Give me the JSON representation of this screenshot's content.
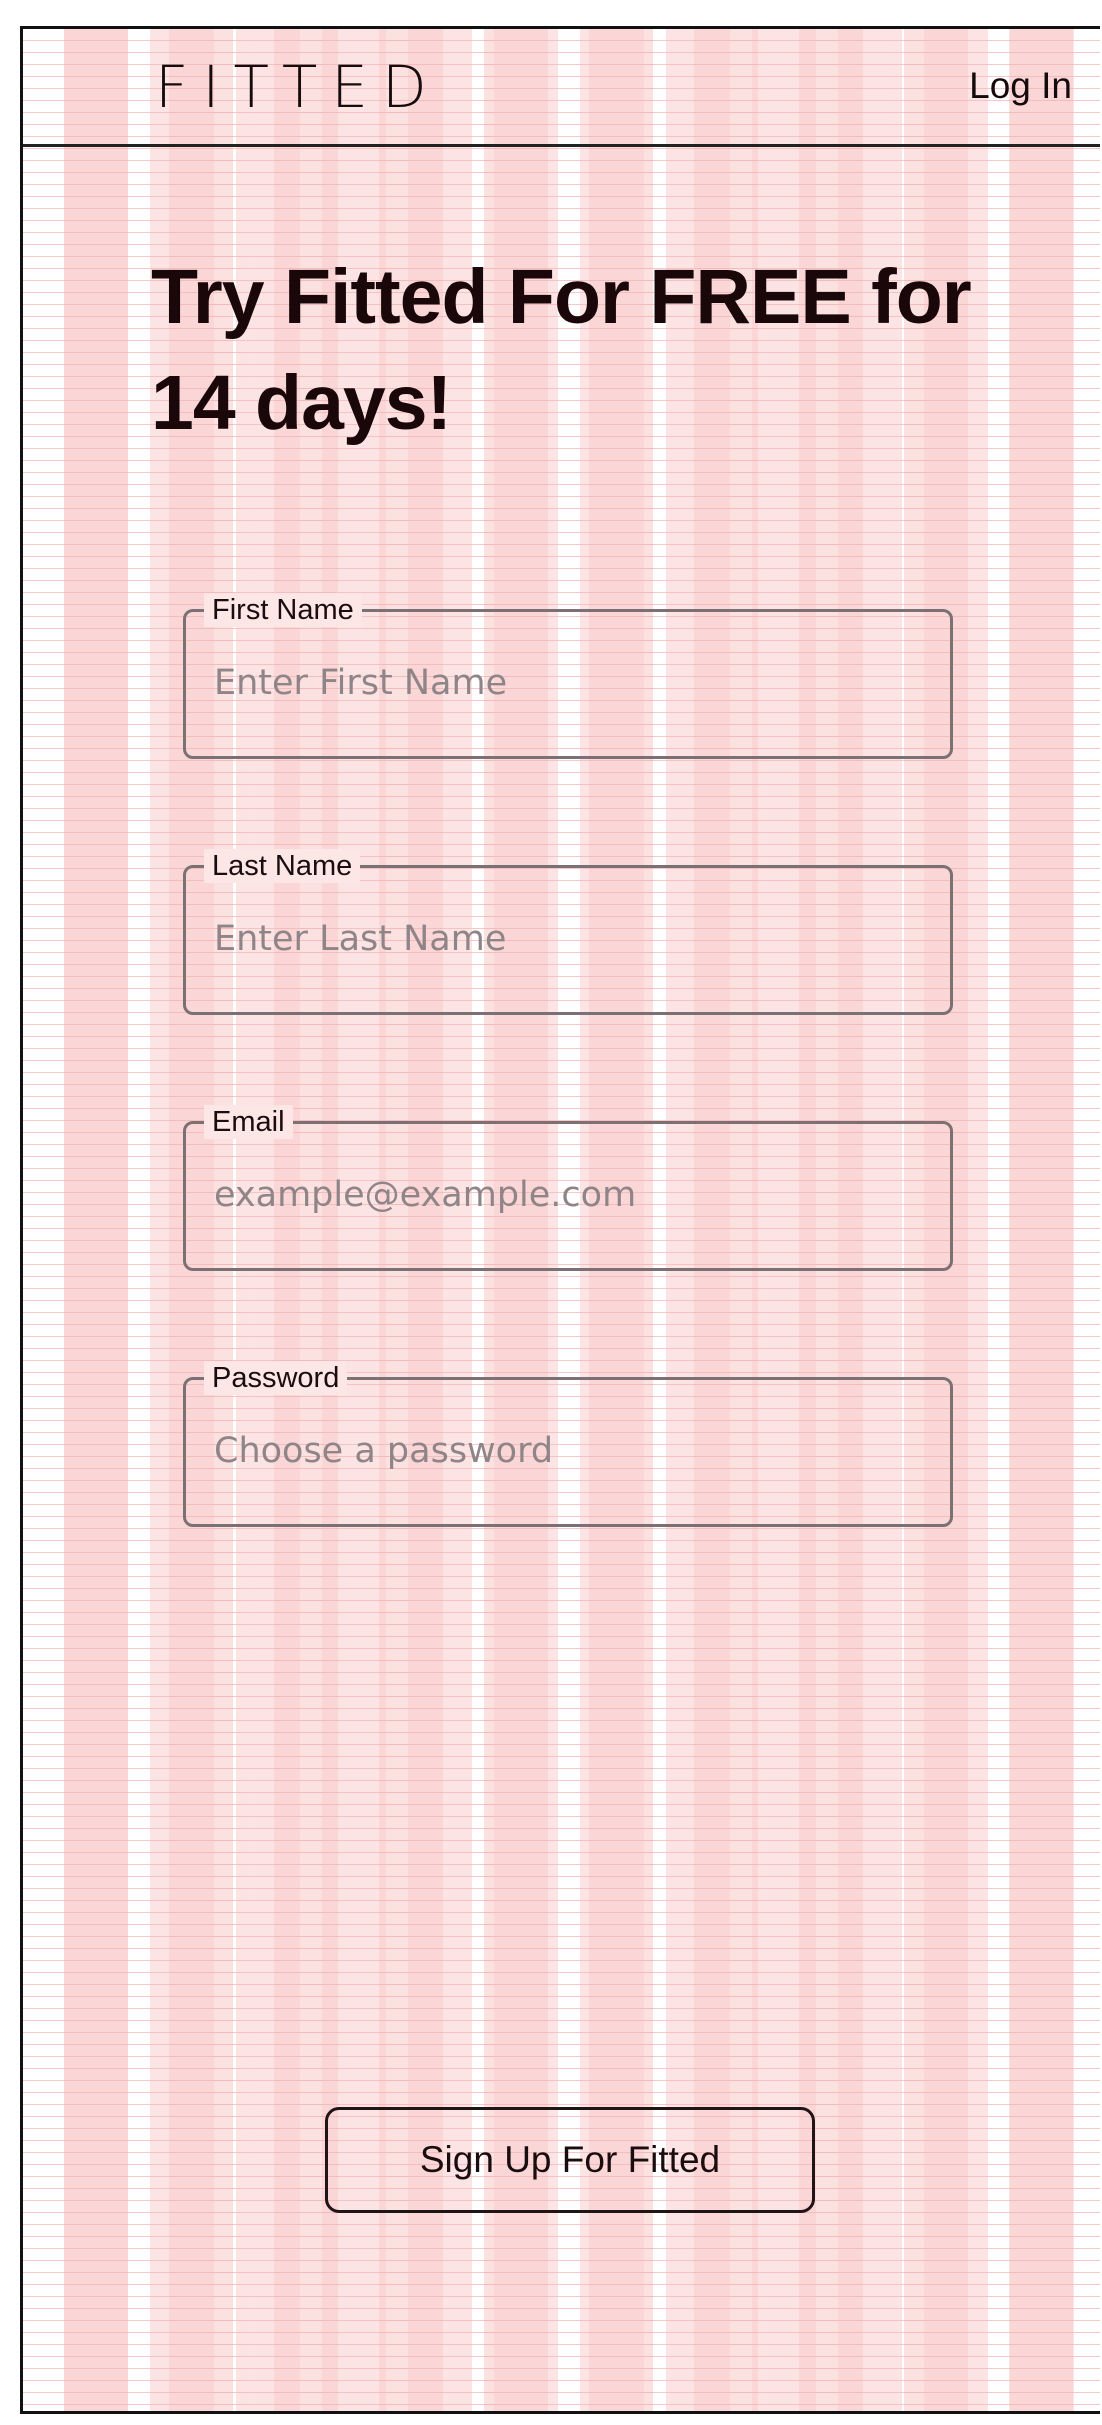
{
  "header": {
    "logo": "FITTED",
    "login_label": "Log In"
  },
  "main": {
    "headline": "Try Fitted For FREE for 14 days!",
    "fields": [
      {
        "label": "First Name",
        "placeholder": "Enter First Name"
      },
      {
        "label": "Last Name",
        "placeholder": "Enter Last Name"
      },
      {
        "label": "Email",
        "placeholder": "example@example.com"
      },
      {
        "label": "Password",
        "placeholder": "Choose a password"
      }
    ],
    "submit_label": "Sign Up For Fitted"
  },
  "colors": {
    "text": "#1a0709",
    "field_border": "#7b7073",
    "placeholder": "#8f8588",
    "grid_column": "#fac8c8"
  }
}
